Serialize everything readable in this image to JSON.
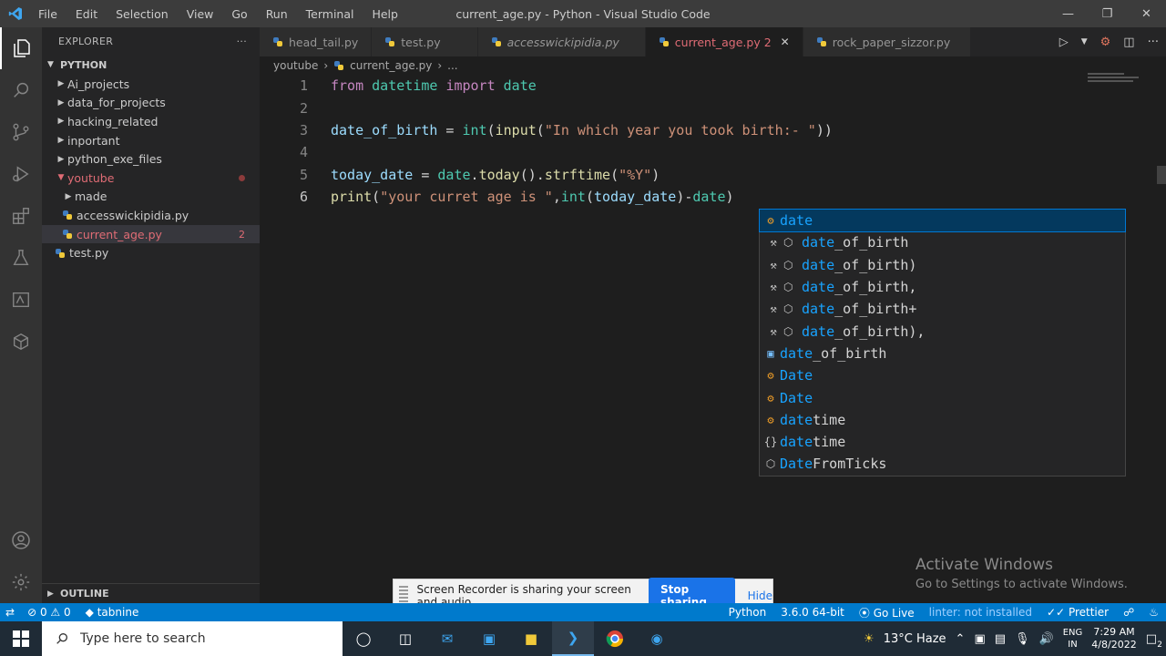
{
  "titlebar": {
    "menu": [
      "File",
      "Edit",
      "Selection",
      "View",
      "Go",
      "Run",
      "Terminal",
      "Help"
    ],
    "title": "current_age.py - Python - Visual Studio Code"
  },
  "sidebar": {
    "header": "EXPLORER",
    "section": "PYTHON",
    "items": [
      {
        "label": "Ai_projects"
      },
      {
        "label": "data_for_projects"
      },
      {
        "label": "hacking_related"
      },
      {
        "label": "inportant"
      },
      {
        "label": "python_exe_files"
      },
      {
        "label": "youtube"
      },
      {
        "label": "made"
      },
      {
        "label": "accesswickipidia.py"
      },
      {
        "label": "current_age.py",
        "badge": "2"
      },
      {
        "label": "test.py"
      }
    ],
    "outline": "OUTLINE"
  },
  "tabs": [
    {
      "label": "head_tail.py"
    },
    {
      "label": "test.py"
    },
    {
      "label": "accesswickipidia.py"
    },
    {
      "label": "current_age.py 2"
    },
    {
      "label": "rock_paper_sizzor.py"
    }
  ],
  "breadcrumb": [
    "youtube",
    "current_age.py",
    "..."
  ],
  "editor": {
    "line_numbers": [
      "1",
      "2",
      "3",
      "4",
      "5",
      "6"
    ],
    "line1": {
      "kw1": "from",
      "mod": "datetime",
      "kw2": "import",
      "cls": "date"
    },
    "line3": {
      "var": "date_of_birth",
      "op": " = ",
      "fn1": "int",
      "p1": "(",
      "fn2": "input",
      "p2": "(",
      "str": "\"In which year you took birth:- \"",
      "p3": "))"
    },
    "line5": {
      "var": "today_date",
      "op": " = ",
      "obj": "date",
      "dot1": ".",
      "fn1": "today",
      "p1": "().",
      "fn2": "strftime",
      "p2": "(",
      "str": "\"%Y\"",
      "p3": ")"
    },
    "line6": {
      "fn": "print",
      "p1": "(",
      "str": "\"your curret age is \"",
      "comma": ",",
      "fn2": "int",
      "p2": "(",
      "var": "today_date",
      "p3": ")-",
      "var2": "date",
      "p4": ")"
    }
  },
  "suggestions": [
    {
      "icon": "class-icon",
      "match": "date",
      "rest": ""
    },
    {
      "icon": "snippet-icon",
      "match": "date",
      "rest": "_of_birth"
    },
    {
      "icon": "snippet-icon",
      "match": "date",
      "rest": "_of_birth)"
    },
    {
      "icon": "snippet-icon",
      "match": "date",
      "rest": "_of_birth,"
    },
    {
      "icon": "snippet-icon",
      "match": "date",
      "rest": "_of_birth+"
    },
    {
      "icon": "snippet-icon",
      "match": "date",
      "rest": "_of_birth),"
    },
    {
      "icon": "variable-icon",
      "match": "date",
      "rest": "_of_birth"
    },
    {
      "icon": "class-icon",
      "match": "Date",
      "rest": ""
    },
    {
      "icon": "class-icon",
      "match": "Date",
      "rest": ""
    },
    {
      "icon": "class-icon",
      "match": "date",
      "rest": "time"
    },
    {
      "icon": "module-icon",
      "match": "date",
      "rest": "time"
    },
    {
      "icon": "method-icon",
      "match": "Date",
      "rest": "FromTicks"
    }
  ],
  "watermark": {
    "line1": "Activate Windows",
    "line2": "Go to Settings to activate Windows."
  },
  "notification": {
    "text": "Screen Recorder is sharing your screen and audio.",
    "stop": "Stop sharing",
    "hide": "Hide"
  },
  "statusbar": {
    "errors": "0",
    "warnings": "0",
    "tabnine": "tabnine",
    "language": "Python",
    "interpreter": "3.6.0 64-bit",
    "golive": "Go Live",
    "lint": "linter: not installed",
    "prettier": "Prettier"
  },
  "taskbar": {
    "search_placeholder": "Type here to search",
    "weather": "13°C  Haze",
    "lang1": "ENG",
    "lang2": "IN",
    "time": "7:29 AM",
    "date": "4/8/2022",
    "notif_count": "2"
  }
}
